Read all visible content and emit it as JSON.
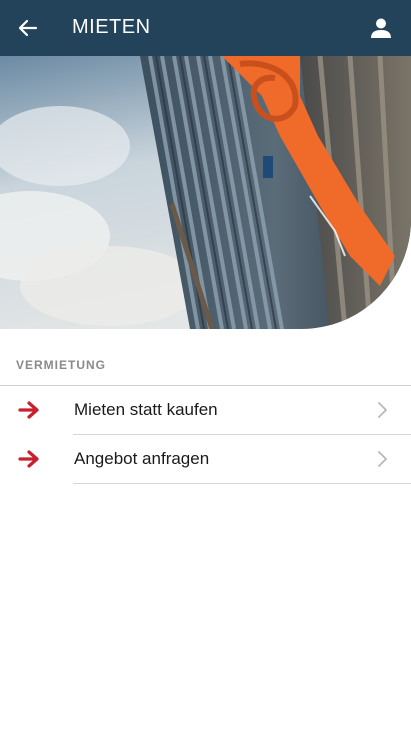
{
  "appbar": {
    "title": "MIETEN",
    "back_icon": "arrow-left-icon",
    "profile_icon": "person-icon",
    "background_color": "#22435a"
  },
  "hero": {
    "description_icon": "scaffolding-photo"
  },
  "section": {
    "label": "VERMIETUNG",
    "items": [
      {
        "label": "Mieten statt kaufen",
        "icon": "red-arrow-right-icon",
        "chevron": "chevron-right-icon"
      },
      {
        "label": "Angebot anfragen",
        "icon": "red-arrow-right-icon",
        "chevron": "chevron-right-icon"
      }
    ]
  },
  "colors": {
    "accent": "#c8202f",
    "chevron": "#b8b8b8",
    "divider": "#d6d6d6"
  }
}
